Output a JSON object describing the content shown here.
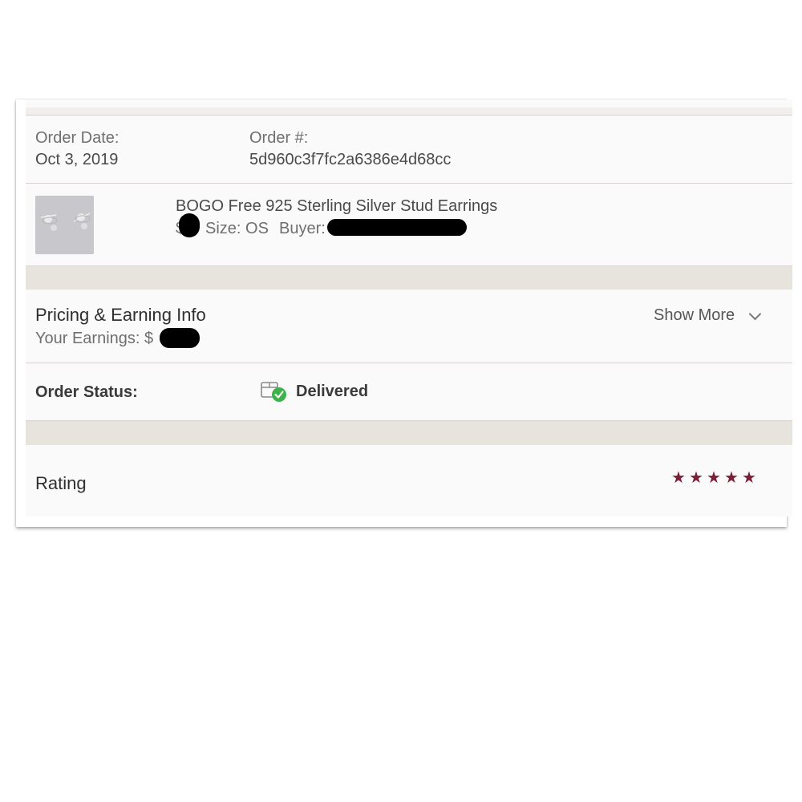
{
  "order": {
    "date_label": "Order Date:",
    "date_value": "Oct 3, 2019",
    "number_label": "Order #:",
    "number_value": "5d960c3f7fc2a6386e4d68cc"
  },
  "item": {
    "title": "BOGO Free 925 Sterling Silver Stud Earrings",
    "price_prefix": "$",
    "size_text": "Size: OS",
    "buyer_label": "Buyer:"
  },
  "pricing": {
    "heading": "Pricing & Earning Info",
    "earnings_label": "Your Earnings: $",
    "show_more_label": "Show More"
  },
  "status": {
    "label": "Order Status:",
    "value": "Delivered",
    "icon": "package-check-icon",
    "check_color": "#3cb24a"
  },
  "rating": {
    "label": "Rating",
    "stars": 5,
    "star_color": "#7b1f36"
  }
}
